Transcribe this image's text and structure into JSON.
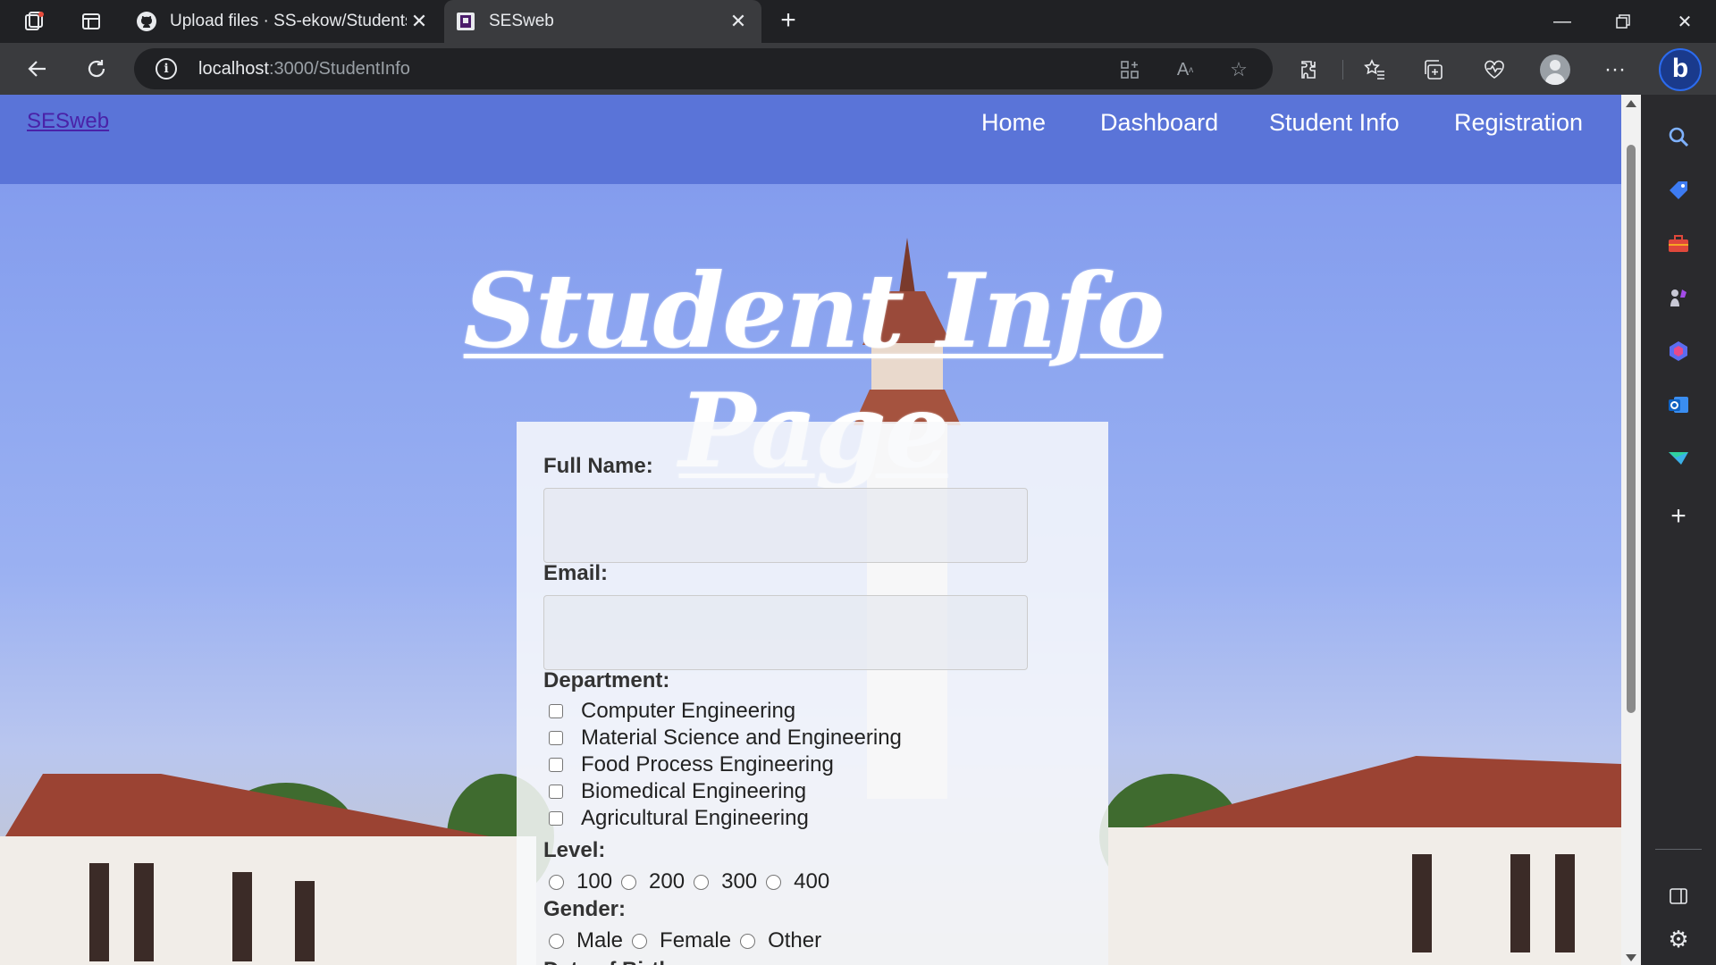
{
  "browser": {
    "tabs": [
      {
        "label": "Upload files · SS-ekow/Students-"
      },
      {
        "label": "SESweb"
      }
    ],
    "address": {
      "host": "localhost",
      "path": ":3000/StudentInfo"
    }
  },
  "site": {
    "brand": "SESweb",
    "nav": [
      "Home",
      "Dashboard",
      "Student Info",
      "Registration"
    ]
  },
  "page": {
    "title": "Student Info Page"
  },
  "form": {
    "full_name_label": "Full Name:",
    "full_name_value": "",
    "email_label": "Email:",
    "email_value": "",
    "department_label": "Department:",
    "departments": [
      "Computer Engineering",
      "Material Science and Engineering",
      "Food Process Engineering",
      "Biomedical Engineering",
      "Agricultural Engineering"
    ],
    "level_label": "Level:",
    "levels": [
      "100",
      "200",
      "300",
      "400"
    ],
    "gender_label": "Gender:",
    "genders": [
      "Male",
      "Female",
      "Other"
    ],
    "dob_label": "Date of Birth:"
  },
  "colors": {
    "header_bg": "#5a74d8",
    "brand_link": "#4a22a8",
    "title_text": "#ffffff"
  }
}
